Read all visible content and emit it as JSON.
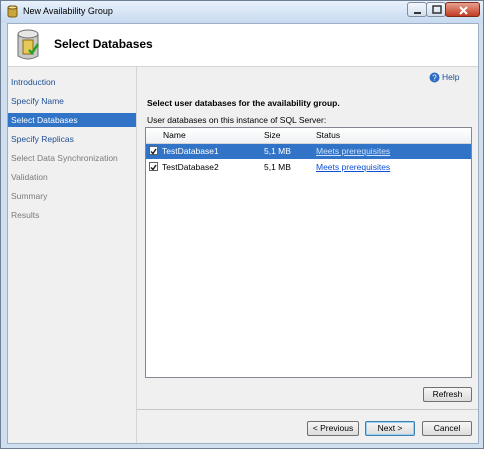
{
  "window": {
    "title": "New Availability Group"
  },
  "header": {
    "title": "Select Databases"
  },
  "sidebar": {
    "items": [
      {
        "label": "Introduction",
        "state": "link"
      },
      {
        "label": "Specify Name",
        "state": "link"
      },
      {
        "label": "Select Databases",
        "state": "active"
      },
      {
        "label": "Specify Replicas",
        "state": "link"
      },
      {
        "label": "Select Data Synchronization",
        "state": "disabled"
      },
      {
        "label": "Validation",
        "state": "disabled"
      },
      {
        "label": "Summary",
        "state": "disabled"
      },
      {
        "label": "Results",
        "state": "disabled"
      }
    ]
  },
  "main": {
    "help_label": "Help",
    "subtitle": "Select user databases for the availability group.",
    "list_label": "User databases on this instance of SQL Server:",
    "columns": [
      "Name",
      "Size",
      "Status"
    ],
    "rows": [
      {
        "name": "TestDatabase1",
        "size": "5,1 MB",
        "status": "Meets prerequisites",
        "checked": true,
        "selected": true
      },
      {
        "name": "TestDatabase2",
        "size": "5,1 MB",
        "status": "Meets prerequisites",
        "checked": true,
        "selected": false
      }
    ],
    "refresh_label": "Refresh"
  },
  "footer": {
    "previous_label": "< Previous",
    "next_label": "Next >",
    "cancel_label": "Cancel"
  }
}
